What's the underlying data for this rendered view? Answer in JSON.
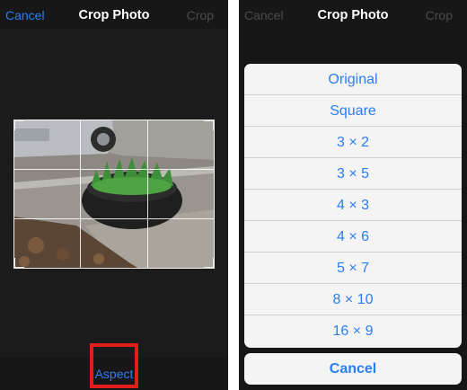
{
  "left": {
    "navbar": {
      "cancel_label": "Cancel",
      "title": "Crop Photo",
      "crop_label": "Crop"
    },
    "toolbar": {
      "aspect_label": "Aspect"
    }
  },
  "right": {
    "navbar": {
      "cancel_label": "Cancel",
      "title": "Crop Photo",
      "crop_label": "Crop"
    },
    "aspect_options": [
      "Original",
      "Square",
      "3 × 2",
      "3 × 5",
      "4 × 3",
      "4 × 6",
      "5 × 7",
      "8 × 10",
      "16 × 9"
    ],
    "cancel_label": "Cancel"
  },
  "colors": {
    "accent": "#2b7ef2",
    "highlight": "#e11d1d",
    "dark_background": "#1e1e1e",
    "sheet_background": "#f4f4f4"
  }
}
